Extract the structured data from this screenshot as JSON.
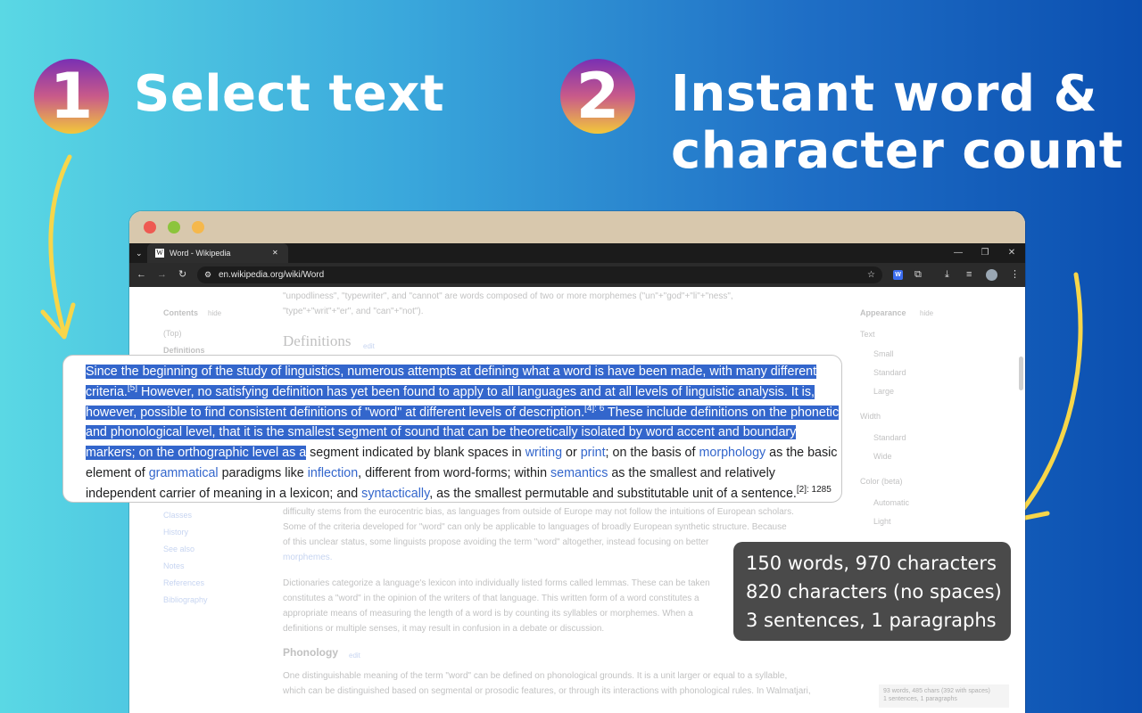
{
  "steps": [
    {
      "number": "1",
      "title": "Select text"
    },
    {
      "number": "2",
      "title_line1": "Instant word &",
      "title_line2": "character count"
    }
  ],
  "browser": {
    "tab_title": "Word - Wikipedia",
    "url": "en.wikipedia.org/wiki/Word",
    "tab_close": "✕",
    "ext_icon": "W"
  },
  "wiki_background": {
    "top_line1": "\"unpodliness\", \"typewriter\", and \"cannot\" are words composed of two or more morphemes (\"un\"+\"god\"+\"li\"+\"ness\",",
    "top_line2": "\"type\"+\"writ\"+\"er\", and \"can\"+\"not\").",
    "contents": "Contents",
    "hide": "hide",
    "top": "(Top)",
    "definitions_nav": "Definitions",
    "heading_definitions": "Definitions",
    "edit": "edit",
    "nav_items": [
      "Classes",
      "History",
      "See also",
      "Notes",
      "References",
      "Bibliography"
    ],
    "appearance": "Appearance",
    "text_label": "Text",
    "text_options": [
      "Small",
      "Standard",
      "Large"
    ],
    "width_label": "Width",
    "width_options": [
      "Standard",
      "Wide"
    ],
    "color_label": "Color (beta)",
    "color_options": [
      "Automatic",
      "Light"
    ],
    "para_lines": [
      "difficulty stems from the eurocentric bias, as languages from outside of Europe may not follow the intuitions of European scholars.",
      "Some of the criteria developed for \"word\" can only be applicable to languages of broadly European synthetic structure. Because",
      "of this unclear status, some linguists propose avoiding the term \"word\" altogether, instead focusing on better",
      "morphemes."
    ],
    "para2_lines": [
      "Dictionaries categorize a language's lexicon into individually listed forms called lemmas. These can be taken",
      "constitutes a \"word\" in the opinion of the writers of that language. This written form of a word constitutes a",
      "appropriate means of measuring the length of a word is by counting its syllables or morphemes. When a",
      "definitions or multiple senses, it may result in confusion in a debate or discussion."
    ],
    "heading_phonology": "Phonology",
    "phon_lines": [
      "One distinguishable meaning of the term \"word\" can be defined on phonological grounds. It is a unit larger or equal to a syllable,",
      "which can be distinguished based on segmental or prosodic features, or through its interactions with phonological rules. In Walmatjari,"
    ],
    "mini_counter_line1": "93 words, 485 chars (392 with spaces)",
    "mini_counter_line2": "1 sentences, 1 paragraphs"
  },
  "selection_card": {
    "line1": "Since the beginning of the study of linguistics, numerous attempts at defining what a word is have been made, with many different",
    "line2_a": "criteria.",
    "line2_sup": "[5]",
    "line2_b": " However, no satisfying definition has yet been found to apply to all languages and at all levels of linguistic analysis. It is,",
    "line3_a": "however, possible to find consistent definitions of \"word\" at different levels of description.",
    "line3_sup": "[4]: 6",
    "line3_b": " These include definitions on the phonetic",
    "line4": "and phonological level, that it is the smallest segment of sound that can be theoretically isolated by word accent and boundary",
    "line5_hl": "markers; on the orthographic level as a",
    "line5_a": " segment indicated by blank spaces in ",
    "line5_link1": "writing",
    "line5_b": " or ",
    "line5_link2": "print",
    "line5_c": "; on the basis of ",
    "line5_link3": "morphology",
    "line5_d": " as the basic",
    "line6_a": "element of ",
    "line6_link1": "grammatical",
    "line6_b": " paradigms like ",
    "line6_link2": "inflection",
    "line6_c": ", different from word-forms; within ",
    "line6_link3": "semantics",
    "line6_d": " as the smallest and relatively",
    "line7_a": "independent carrier of meaning in a lexicon; and ",
    "line7_link": "syntactically",
    "line7_b": ", as the smallest permutable and substitutable unit of a sentence.",
    "line7_sup": "[2]: 1285"
  },
  "counter": {
    "line1": "150 words, 970 characters",
    "line2": "820 characters (no spaces)",
    "line3": "3 sentences, 1 paragraphs"
  },
  "colors": {
    "selection": "#3366cc",
    "link": "#3366cc",
    "counter_bg": "#4a4a4a",
    "arrow": "#f7d64a"
  }
}
